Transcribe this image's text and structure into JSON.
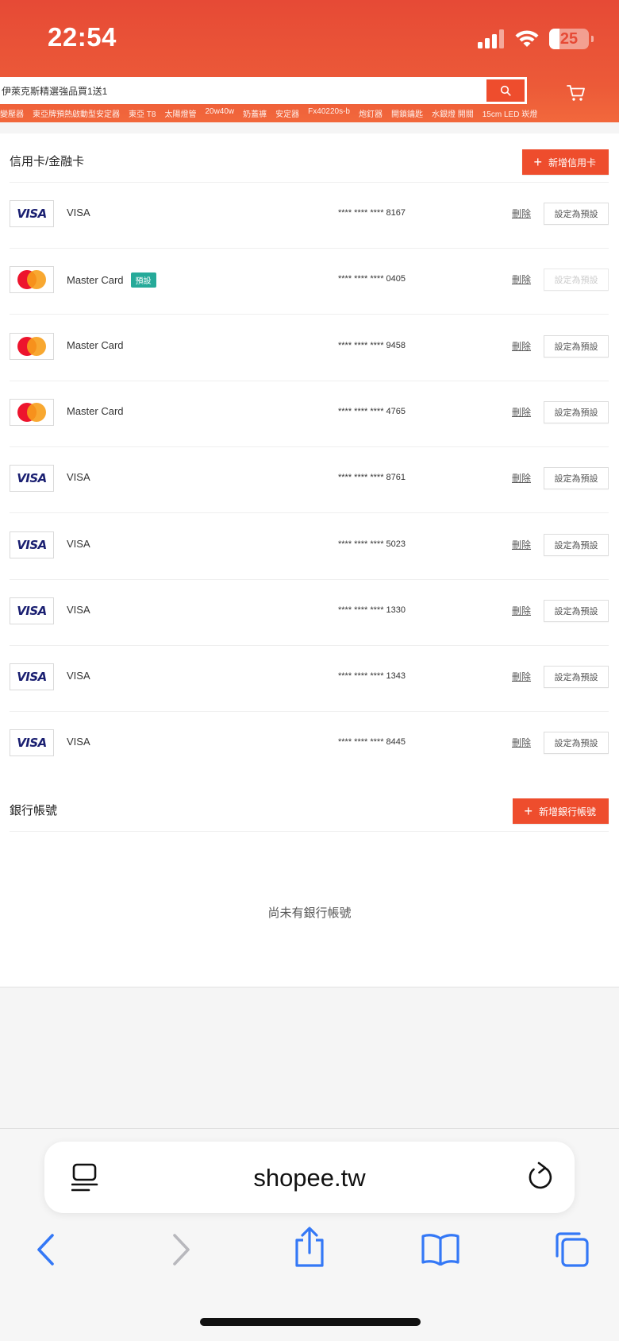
{
  "status_bar": {
    "time": "22:54",
    "battery": "25"
  },
  "header": {
    "search_text": "伊萊克斯精選強品買1送1",
    "hints": [
      "變壓器",
      "東亞牌預熱啟動型安定器",
      "東亞 T8",
      "太陽燈管",
      "20w40w",
      "奶蓋褲",
      "安定器",
      "Fx40220s-b",
      "炮釘器",
      "開鎖鑰匙",
      "水銀燈 開關",
      "15cm LED 崁燈"
    ]
  },
  "credit_section": {
    "title": "信用卡/金融卡",
    "add_label": "新增信用卡",
    "delete_label": "刪除",
    "set_default_label": "設定為預設",
    "cards": [
      {
        "brand": "VISA",
        "name": "VISA",
        "number": "**** **** **** 8167",
        "is_default": false
      },
      {
        "brand": "Master Card",
        "name": "Master Card",
        "number": "**** **** **** 0405",
        "is_default": true,
        "badge": "預設"
      },
      {
        "brand": "Master Card",
        "name": "Master Card",
        "number": "**** **** **** 9458",
        "is_default": false
      },
      {
        "brand": "Master Card",
        "name": "Master Card",
        "number": "**** **** **** 4765",
        "is_default": false
      },
      {
        "brand": "VISA",
        "name": "VISA",
        "number": "**** **** **** 8761",
        "is_default": false
      },
      {
        "brand": "VISA",
        "name": "VISA",
        "number": "**** **** **** 5023",
        "is_default": false
      },
      {
        "brand": "VISA",
        "name": "VISA",
        "number": "**** **** **** 1330",
        "is_default": false
      },
      {
        "brand": "VISA",
        "name": "VISA",
        "number": "**** **** **** 1343",
        "is_default": false
      },
      {
        "brand": "VISA",
        "name": "VISA",
        "number": "**** **** **** 8445",
        "is_default": false
      }
    ]
  },
  "bank_section": {
    "title": "銀行帳號",
    "add_label": "新增銀行帳號",
    "empty_text": "尚未有銀行帳號"
  },
  "browser": {
    "url": "shopee.tw"
  },
  "colors": {
    "brand": "#ee4d2d",
    "badge": "#26aa99",
    "visa": "#1a1f71",
    "ios_blue": "#3478f6"
  }
}
